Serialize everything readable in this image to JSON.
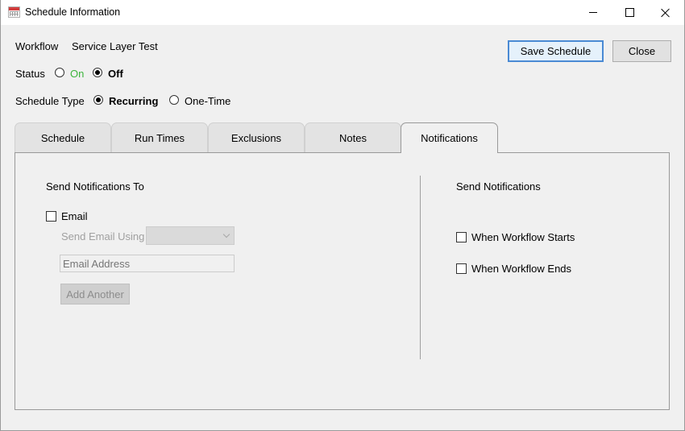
{
  "window": {
    "title": "Schedule Information",
    "controls": {
      "minimize": "minimize-icon",
      "maximize": "maximize-icon",
      "close": "close-icon"
    }
  },
  "workflow": {
    "label": "Workflow",
    "value": "Service Layer Test"
  },
  "status": {
    "label": "Status",
    "options": [
      {
        "label": "On",
        "checked": false,
        "color": "#3cb43c"
      },
      {
        "label": "Off",
        "checked": true
      }
    ]
  },
  "schedule_type": {
    "label": "Schedule Type",
    "options": [
      {
        "label": "Recurring",
        "checked": true
      },
      {
        "label": "One-Time",
        "checked": false
      }
    ]
  },
  "buttons": {
    "save": "Save Schedule",
    "close": "Close"
  },
  "tabs": [
    {
      "label": "Schedule",
      "active": false
    },
    {
      "label": "Run Times",
      "active": false
    },
    {
      "label": "Exclusions",
      "active": false
    },
    {
      "label": "Notes",
      "active": false
    },
    {
      "label": "Notifications",
      "active": true
    }
  ],
  "notifications": {
    "send_to_heading": "Send Notifications To",
    "email_label": "Email",
    "email_checked": false,
    "send_using_label": "Send Email Using",
    "send_using_value": "",
    "email_placeholder": "Email Address",
    "add_another": "Add Another",
    "send_heading": "Send Notifications",
    "when_starts": "When Workflow Starts",
    "when_starts_checked": false,
    "when_ends": "When Workflow Ends",
    "when_ends_checked": false
  }
}
